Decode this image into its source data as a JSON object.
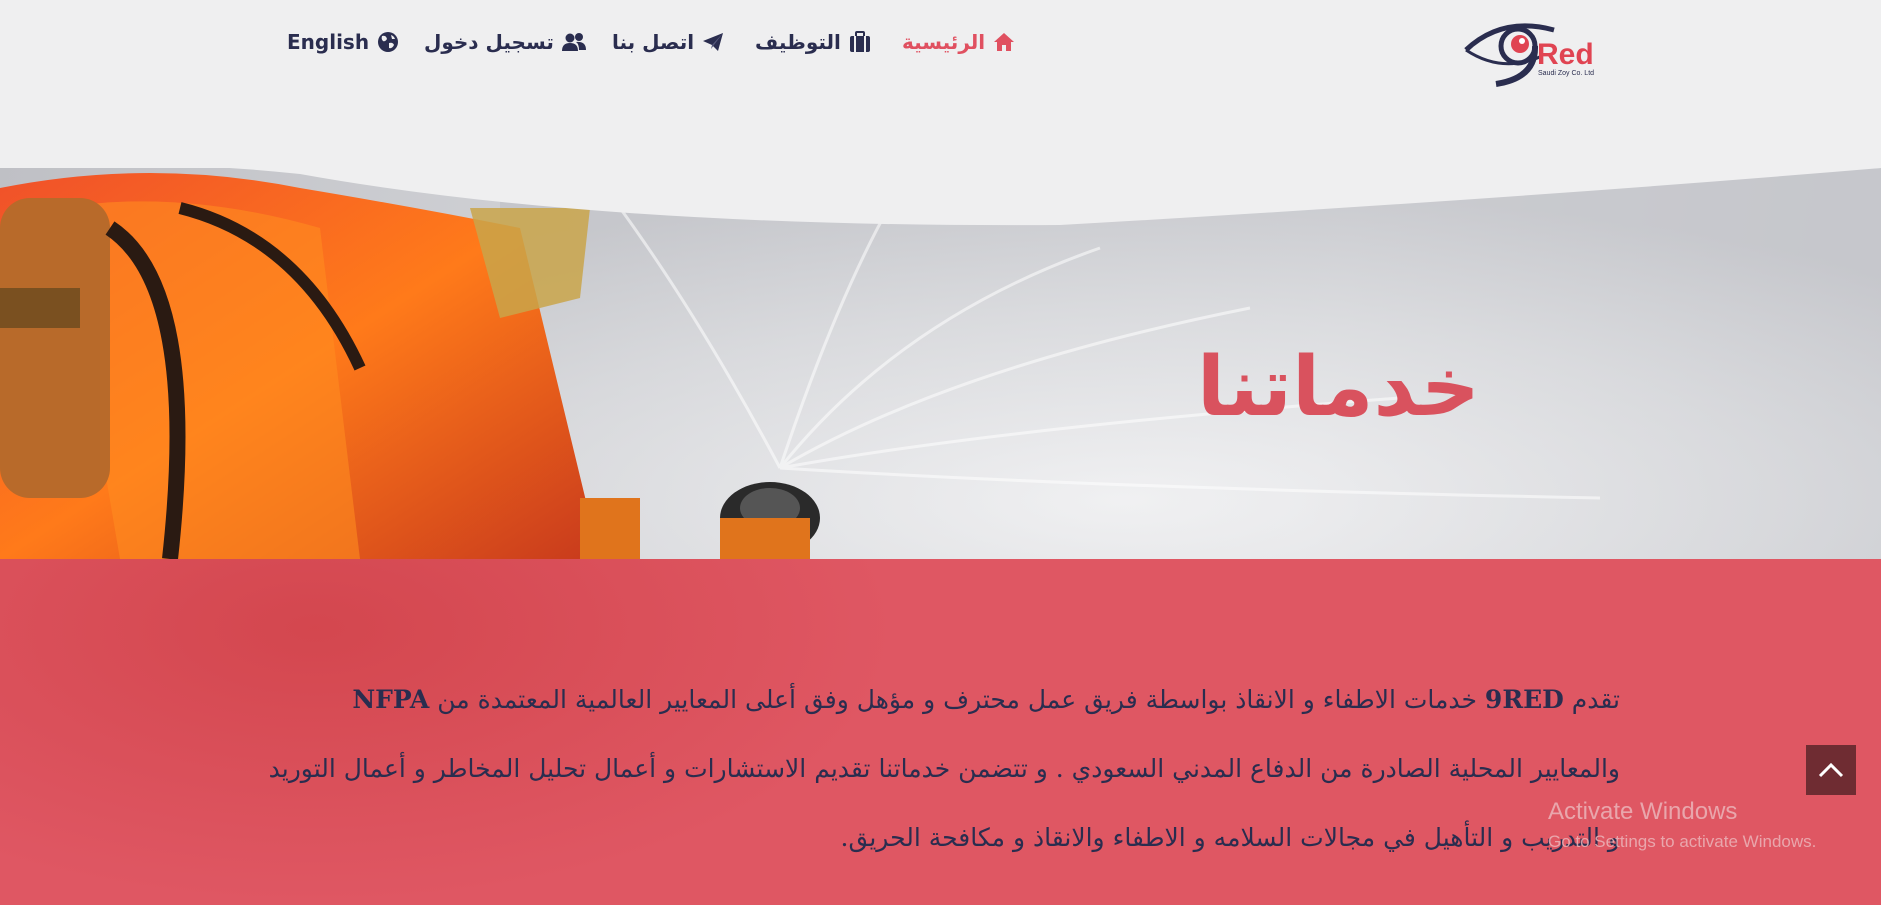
{
  "logo": {
    "text": "Red",
    "tagline": "Saudi Zoy Co. Ltd",
    "colors": {
      "primary": "#2a2d4f",
      "accent": "#e04452"
    }
  },
  "nav": {
    "items": [
      {
        "label": "الرئيسية",
        "icon": "home-icon",
        "active": true
      },
      {
        "label": "التوظيف",
        "icon": "briefcase-icon",
        "active": false
      },
      {
        "label": "اتصل بنا",
        "icon": "paper-plane-icon",
        "active": false
      },
      {
        "label": "تسجيل دخول",
        "icon": "users-icon",
        "active": false
      },
      {
        "label": "English",
        "icon": "globe-icon",
        "active": false
      }
    ]
  },
  "hero": {
    "title": "خدماتنا"
  },
  "intro": {
    "lead": "تقدم",
    "brand": "9RED",
    "text_1": "خدمات الاطفاء و الانقاذ بواسطة فريق عمل محترف و مؤهل وفق أعلى المعايير العالمية المعتمدة من",
    "org": "NFPA",
    "text_2": "والمعايير المحلية الصادرة من الدفاع المدني السعودي . و تتضمن خدماتنا تقديم الاستشارات و أعمال تحليل المخاطر و أعمال التوريد و التدريب و التأهيل في مجالات السلامه و الاطفاء والانقاذ و مكافحة الحريق."
  },
  "watermark": {
    "title": "Activate Windows",
    "subtitle": "Go to Settings to activate Windows."
  },
  "colors": {
    "background": "#efeff0",
    "accent": "#e05060",
    "nav_text": "#2a2d4f",
    "band": "#de4b58",
    "back_to_top": "#6f2c32"
  },
  "back_to_top": {
    "icon": "chevron-up-icon"
  }
}
